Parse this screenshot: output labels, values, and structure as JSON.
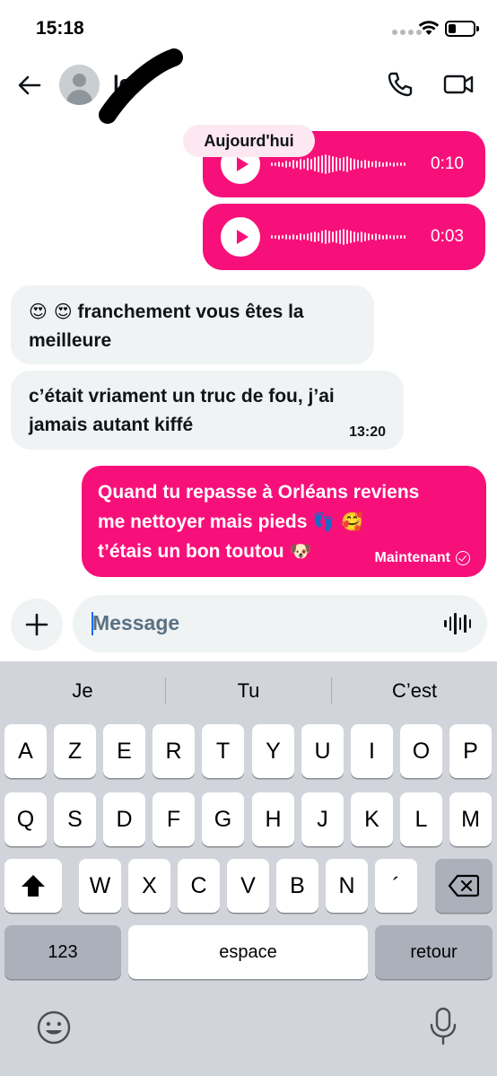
{
  "status_bar": {
    "time": "15:18"
  },
  "header": {
    "contact_name": "le",
    "back_icon": "arrow-left-icon",
    "call_icon": "phone-icon",
    "video_icon": "video-camera-icon"
  },
  "conversation": {
    "date_label": "Aujourd'hui",
    "voice_messages": [
      {
        "duration": "0:10"
      },
      {
        "duration": "0:03"
      }
    ],
    "incoming": [
      {
        "emoji": "😍 😍",
        "text": " franchement vous êtes la meilleure"
      },
      {
        "text": "c’était vriament un truc de fou, j’ai jamais autant kiffé",
        "time": "13:20"
      }
    ],
    "outgoing": {
      "line1": "Quand tu repasse à Orléans reviens",
      "line2": "me nettoyer mais pieds",
      "emoji2": "👣 🥰",
      "line3": "t’étais un bon toutou",
      "emoji3": "🐶",
      "time": "Maintenant"
    }
  },
  "composer": {
    "placeholder": "Message"
  },
  "keyboard": {
    "suggestions": [
      "Je",
      "Tu",
      "C’est"
    ],
    "row1": [
      "A",
      "Z",
      "E",
      "R",
      "T",
      "Y",
      "U",
      "I",
      "O",
      "P"
    ],
    "row2": [
      "Q",
      "S",
      "D",
      "F",
      "G",
      "H",
      "J",
      "K",
      "L",
      "M"
    ],
    "row3": [
      "W",
      "X",
      "C",
      "V",
      "B",
      "N",
      "´"
    ],
    "numbers_label": "123",
    "space_label": "espace",
    "return_label": "retour"
  },
  "colors": {
    "accent": "#f8107a",
    "bubble_in": "#eff3f4",
    "keyboard_bg": "#d1d4db"
  }
}
